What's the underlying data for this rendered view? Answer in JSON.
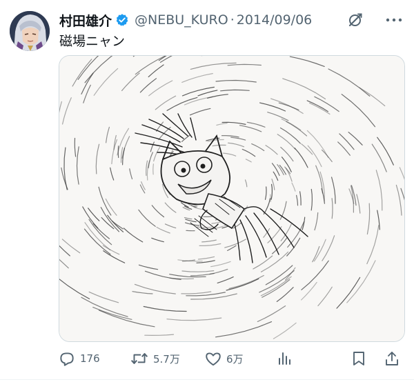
{
  "post": {
    "author_name": "村田雄介",
    "handle": "@NEBU_KURO",
    "separator": "·",
    "date": "2014/09/06",
    "text": "磁場ニャン"
  },
  "actions": {
    "replies": "176",
    "reposts": "5.7万",
    "likes": "6万"
  },
  "colors": {
    "verified": "#1d9bf0",
    "secondary_text": "#536471",
    "primary_text": "#0f1419"
  },
  "icons": [
    "verified-badge-icon",
    "grok-icon",
    "more-icon",
    "reply-icon",
    "repost-icon",
    "like-icon",
    "views-icon",
    "bookmark-icon",
    "share-icon"
  ]
}
